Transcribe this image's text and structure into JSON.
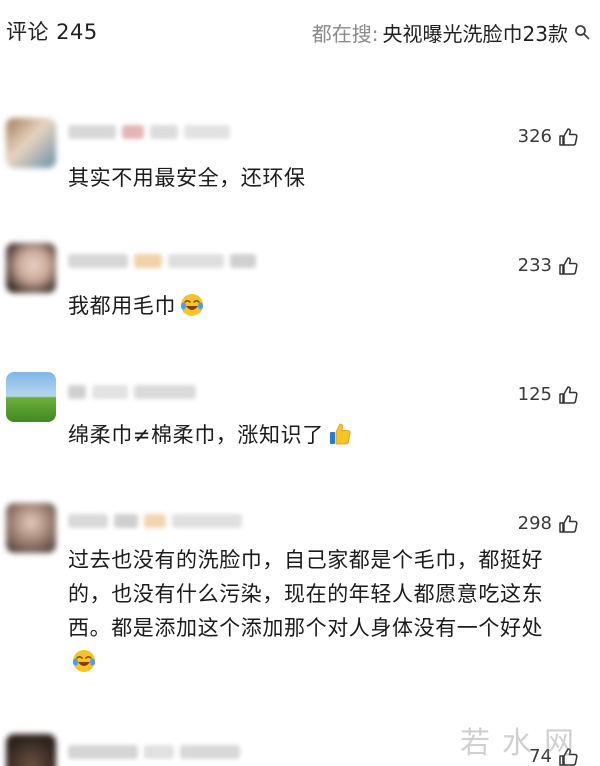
{
  "header": {
    "comment_count": "评论 245",
    "search_prefix": "都在搜:",
    "search_term": "央视曝光洗脸巾23款"
  },
  "comments": [
    {
      "likes": "326",
      "text": "其实不用最安全，还环保",
      "emoji": null
    },
    {
      "likes": "233",
      "text": "我都用毛巾",
      "emoji": "crying-laughing-emoji"
    },
    {
      "likes": "125",
      "text": "绵柔巾≠棉柔巾，涨知识了",
      "emoji": "thumbs-up-emoji"
    },
    {
      "likes": "298",
      "text": "过去也没有的洗脸巾，自己家都是个毛巾，都挺好的，也没有什么污染，现在的年轻人都愿意吃这东西。都是添加这个添加那个对人身体没有一个好处",
      "emoji": "crying-laughing-emoji"
    },
    {
      "likes": "74",
      "text": "",
      "emoji": null
    }
  ],
  "watermark": "若水网",
  "icons": {
    "search": "search-icon",
    "like": "thumbs-up-outline-icon"
  },
  "colors": {
    "text": "#1b1b1b",
    "muted": "#8a8a8a",
    "background": "#ffffff"
  }
}
